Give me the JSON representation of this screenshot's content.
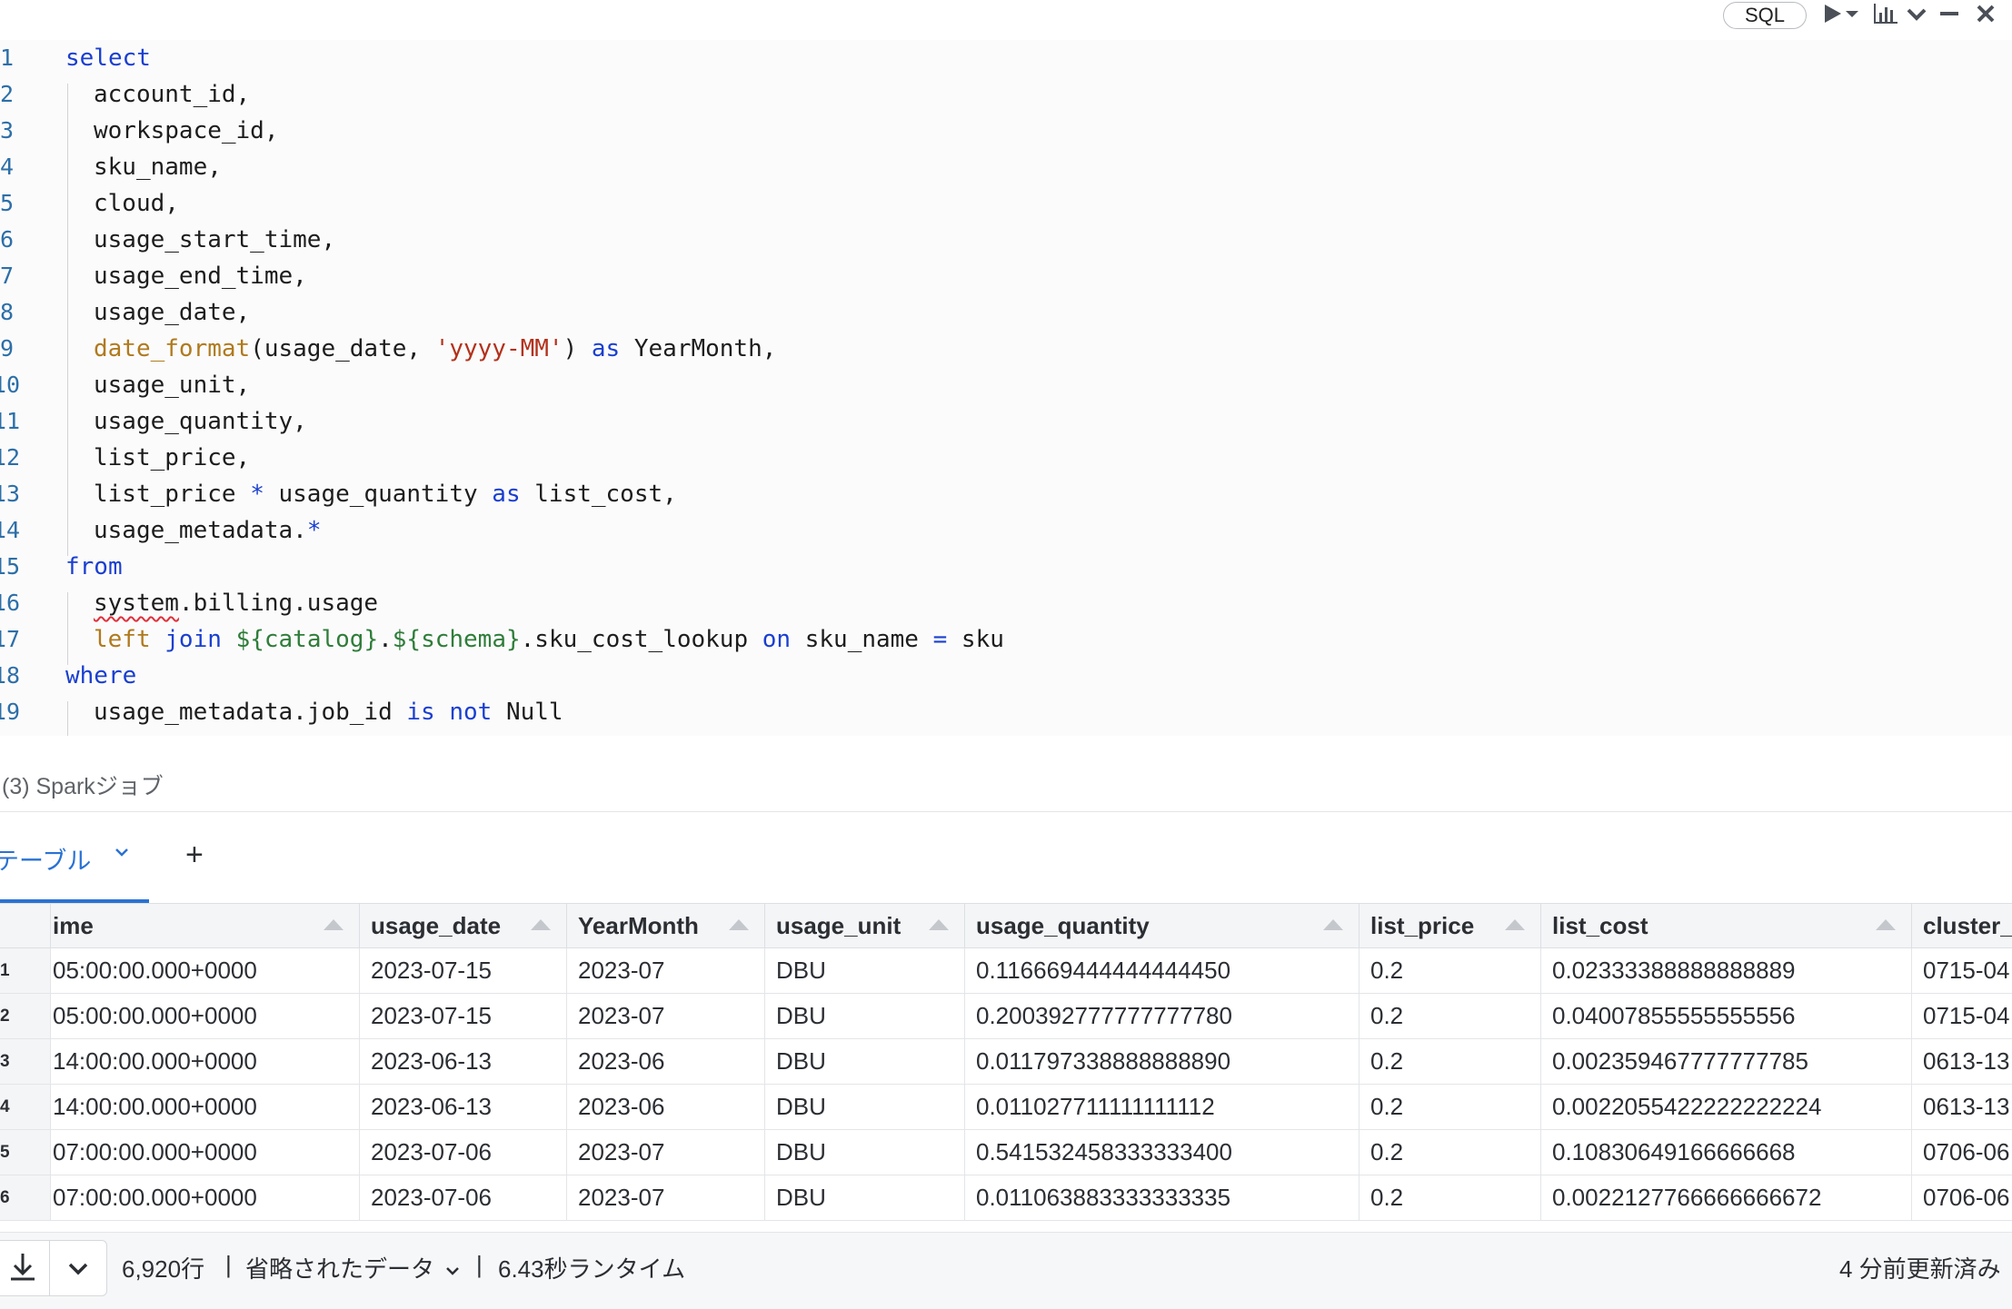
{
  "toolbar": {
    "language": "SQL",
    "icons": [
      "run-icon",
      "run-dropdown-icon",
      "chart-icon",
      "collapse-icon",
      "minimize-icon",
      "close-icon"
    ]
  },
  "editor": {
    "lines": [
      {
        "num": "1",
        "tokens": [
          {
            "t": "select",
            "c": "kw"
          }
        ]
      },
      {
        "num": "2",
        "tokens": [
          {
            "t": "account_id,",
            "c": ""
          }
        ]
      },
      {
        "num": "3",
        "tokens": [
          {
            "t": "workspace_id,",
            "c": ""
          }
        ]
      },
      {
        "num": "4",
        "tokens": [
          {
            "t": "sku_name,",
            "c": ""
          }
        ]
      },
      {
        "num": "5",
        "tokens": [
          {
            "t": "cloud,",
            "c": ""
          }
        ]
      },
      {
        "num": "6",
        "tokens": [
          {
            "t": "usage_start_time,",
            "c": ""
          }
        ]
      },
      {
        "num": "7",
        "tokens": [
          {
            "t": "usage_end_time,",
            "c": ""
          }
        ]
      },
      {
        "num": "8",
        "tokens": [
          {
            "t": "usage_date,",
            "c": ""
          }
        ]
      },
      {
        "num": "9",
        "tokens": [
          {
            "t": "date_format",
            "c": "fn"
          },
          {
            "t": "(usage_date, ",
            "c": ""
          },
          {
            "t": "'yyyy-MM'",
            "c": "str"
          },
          {
            "t": ") ",
            "c": ""
          },
          {
            "t": "as",
            "c": "kw"
          },
          {
            "t": " YearMonth,",
            "c": ""
          }
        ]
      },
      {
        "num": "10",
        "tokens": [
          {
            "t": "usage_unit,",
            "c": ""
          }
        ]
      },
      {
        "num": "11",
        "tokens": [
          {
            "t": "usage_quantity,",
            "c": ""
          }
        ]
      },
      {
        "num": "12",
        "tokens": [
          {
            "t": "list_price,",
            "c": ""
          }
        ]
      },
      {
        "num": "13",
        "tokens": [
          {
            "t": "list_price ",
            "c": ""
          },
          {
            "t": "*",
            "c": "kw"
          },
          {
            "t": " usage_quantity ",
            "c": ""
          },
          {
            "t": "as",
            "c": "kw"
          },
          {
            "t": " list_cost,",
            "c": ""
          }
        ]
      },
      {
        "num": "14",
        "tokens": [
          {
            "t": "usage_metadata.",
            "c": ""
          },
          {
            "t": "*",
            "c": "kw"
          }
        ]
      },
      {
        "num": "15",
        "tokens": [
          {
            "t": "from",
            "c": "kw"
          }
        ]
      },
      {
        "num": "16",
        "tokens": [
          {
            "t": "system",
            "c": "squig"
          },
          {
            "t": ".billing.usage",
            "c": ""
          }
        ]
      },
      {
        "num": "17",
        "tokens": [
          {
            "t": "left",
            "c": "fn"
          },
          {
            "t": " ",
            "c": ""
          },
          {
            "t": "join",
            "c": "kw"
          },
          {
            "t": " ",
            "c": ""
          },
          {
            "t": "${catalog}",
            "c": "tpl"
          },
          {
            "t": ".",
            "c": ""
          },
          {
            "t": "${schema}",
            "c": "tpl"
          },
          {
            "t": ".sku_cost_lookup ",
            "c": ""
          },
          {
            "t": "on",
            "c": "kw"
          },
          {
            "t": " sku_name ",
            "c": ""
          },
          {
            "t": "=",
            "c": "kw"
          },
          {
            "t": " sku",
            "c": ""
          }
        ]
      },
      {
        "num": "18",
        "tokens": [
          {
            "t": "where",
            "c": "kw"
          }
        ]
      },
      {
        "num": "19",
        "tokens": [
          {
            "t": "usage_metadata.job_id ",
            "c": ""
          },
          {
            "t": "is",
            "c": "kw"
          },
          {
            "t": " ",
            "c": ""
          },
          {
            "t": "not",
            "c": "kw"
          },
          {
            "t": " Null",
            "c": ""
          }
        ]
      }
    ]
  },
  "spark_jobs": "(3) Sparkジョブ",
  "tabs": {
    "active": "テーブル",
    "add_label": "+"
  },
  "table": {
    "columns": [
      "ime",
      "usage_date",
      "YearMonth",
      "usage_unit",
      "usage_quantity",
      "list_price",
      "list_cost",
      "cluster_"
    ],
    "rows": [
      {
        "n": "1",
        "cells": [
          "05:00:00.000+0000",
          "2023-07-15",
          "2023-07",
          "DBU",
          "0.116669444444444450",
          "0.2",
          "0.02333388888888889",
          "0715-04"
        ]
      },
      {
        "n": "2",
        "cells": [
          "05:00:00.000+0000",
          "2023-07-15",
          "2023-07",
          "DBU",
          "0.200392777777777780",
          "0.2",
          "0.04007855555555556",
          "0715-04"
        ]
      },
      {
        "n": "3",
        "cells": [
          "14:00:00.000+0000",
          "2023-06-13",
          "2023-06",
          "DBU",
          "0.011797338888888890",
          "0.2",
          "0.002359467777777785",
          "0613-13"
        ]
      },
      {
        "n": "4",
        "cells": [
          "14:00:00.000+0000",
          "2023-06-13",
          "2023-06",
          "DBU",
          "0.011027711111111112",
          "0.2",
          "0.0022055422222222224",
          "0613-13"
        ]
      },
      {
        "n": "5",
        "cells": [
          "07:00:00.000+0000",
          "2023-07-06",
          "2023-07",
          "DBU",
          "0.541532458333333400",
          "0.2",
          "0.10830649166666668",
          "0706-06"
        ]
      },
      {
        "n": "6",
        "cells": [
          "07:00:00.000+0000",
          "2023-07-06",
          "2023-07",
          "DBU",
          "0.011063883333333335",
          "0.2",
          "0.0022127766666666672",
          "0706-06"
        ]
      }
    ]
  },
  "footer": {
    "rows": "6,920行",
    "sep1": "|",
    "truncated": "省略されたデータ",
    "sep2": "|",
    "runtime": "6.43秒ランタイム",
    "updated": "4 分前更新済み"
  },
  "colors": {
    "keyword": "#1a3fd0",
    "function": "#b07a1e",
    "string": "#b3311c",
    "template": "#2f7d3a",
    "tab_active": "#2a72d4"
  }
}
